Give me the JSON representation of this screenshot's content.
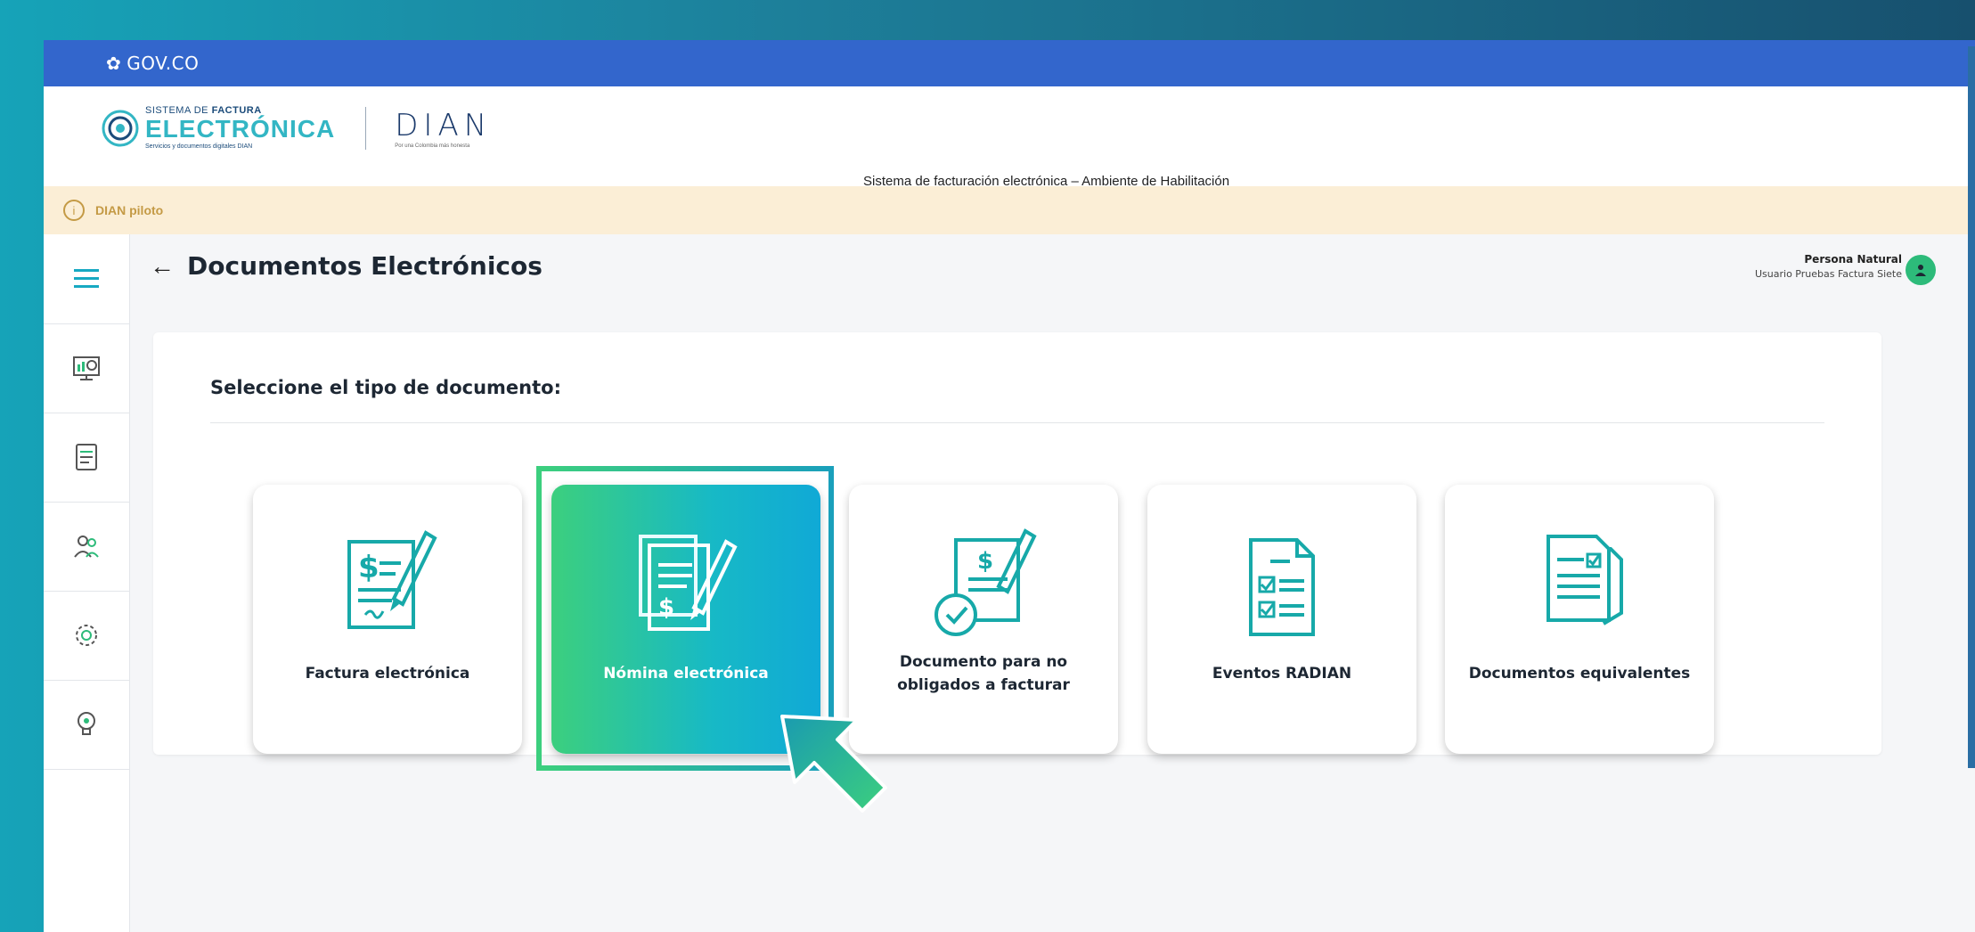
{
  "gov_bar": {
    "label": "GOV.CO"
  },
  "brand": {
    "line1_prefix": "SISTEMA DE",
    "line1_bold": "FACTURA",
    "big": "ELECTRÓNICA",
    "sub": "Servicios y documentos digitales DIAN",
    "dian": "DIAN",
    "dian_sub": "Por una Colombia más honesta"
  },
  "header": {
    "title": "Sistema de facturación electrónica – Ambiente de Habilitación"
  },
  "notice": {
    "text": "DIAN piloto"
  },
  "page": {
    "title": "Documentos Electrónicos"
  },
  "user": {
    "role": "Persona Natural",
    "name": "Usuario Pruebas Factura Siete"
  },
  "panel": {
    "title": "Seleccione el tipo de documento:"
  },
  "cards": [
    {
      "label": "Factura electrónica",
      "active": false
    },
    {
      "label": "Nómina electrónica",
      "active": true
    },
    {
      "label": "Documento para no obligados a facturar",
      "active": false
    },
    {
      "label": "Eventos RADIAN",
      "active": false
    },
    {
      "label": "Documentos equivalentes",
      "active": false
    }
  ],
  "sidebar": [
    "menu-icon",
    "dashboard-icon",
    "documents-icon",
    "users-icon",
    "settings-icon",
    "idea-icon"
  ],
  "colors": {
    "gov_blue": "#3366cc",
    "accent_teal": "#17b9c6",
    "accent_green": "#3ccf7e",
    "notice_bg": "#fbeed6"
  }
}
